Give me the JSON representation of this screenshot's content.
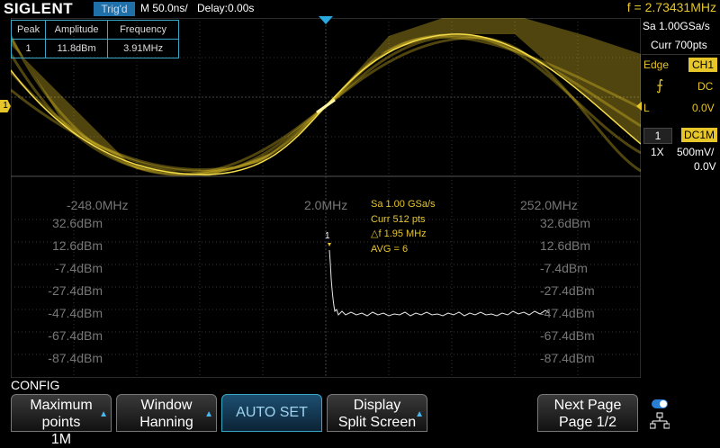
{
  "topbar": {
    "brand": "SIGLENT",
    "trigger_status": "Trig'd",
    "timebase": "M 50.0ns/",
    "delay": "Delay:0.00s",
    "frequency_readout": "f = 2.73431MHz"
  },
  "acquisition": {
    "sample_rate": "Sa 1.00GSa/s",
    "current_points": "Curr 700pts"
  },
  "trigger": {
    "type": "Edge",
    "source": "CH1",
    "coupling": "DC",
    "level_label": "L",
    "level": "0.0V"
  },
  "channel": {
    "number": "1",
    "coupling": "DC1M",
    "probe": "1X",
    "scale": "500mV/",
    "offset": "0.0V"
  },
  "peak_table": {
    "headers": [
      "Peak",
      "Amplitude",
      "Frequency"
    ],
    "rows": [
      [
        "1",
        "11.8dBm",
        "3.91MHz"
      ]
    ]
  },
  "fft": {
    "x_labels": [
      "-248.0MHz",
      "2.0MHz",
      "252.0MHz"
    ],
    "y_labels": [
      "32.6dBm",
      "12.6dBm",
      "-7.4dBm",
      "-27.4dBm",
      "-47.4dBm",
      "-67.4dBm",
      "-87.4dBm"
    ],
    "info": [
      "Sa 1.00 GSa/s",
      "Curr 512 pts",
      "△f 1.95 MHz",
      "AVG = 6"
    ],
    "peak_marker": "1",
    "ch_marker": "1"
  },
  "menu": {
    "title": "CONFIG",
    "max_points_label": "Maximum points",
    "max_points_value": "1M",
    "window_label": "Window",
    "window_value": "Hanning",
    "auto_set": "AUTO SET",
    "display_label": "Display",
    "display_value": "Split Screen",
    "next_page_label": "Next Page",
    "next_page_value": "Page 1/2"
  },
  "colors": {
    "trace": "#e6c629",
    "accent": "#3aa7c7",
    "fft_trace": "#e8e8e8"
  }
}
